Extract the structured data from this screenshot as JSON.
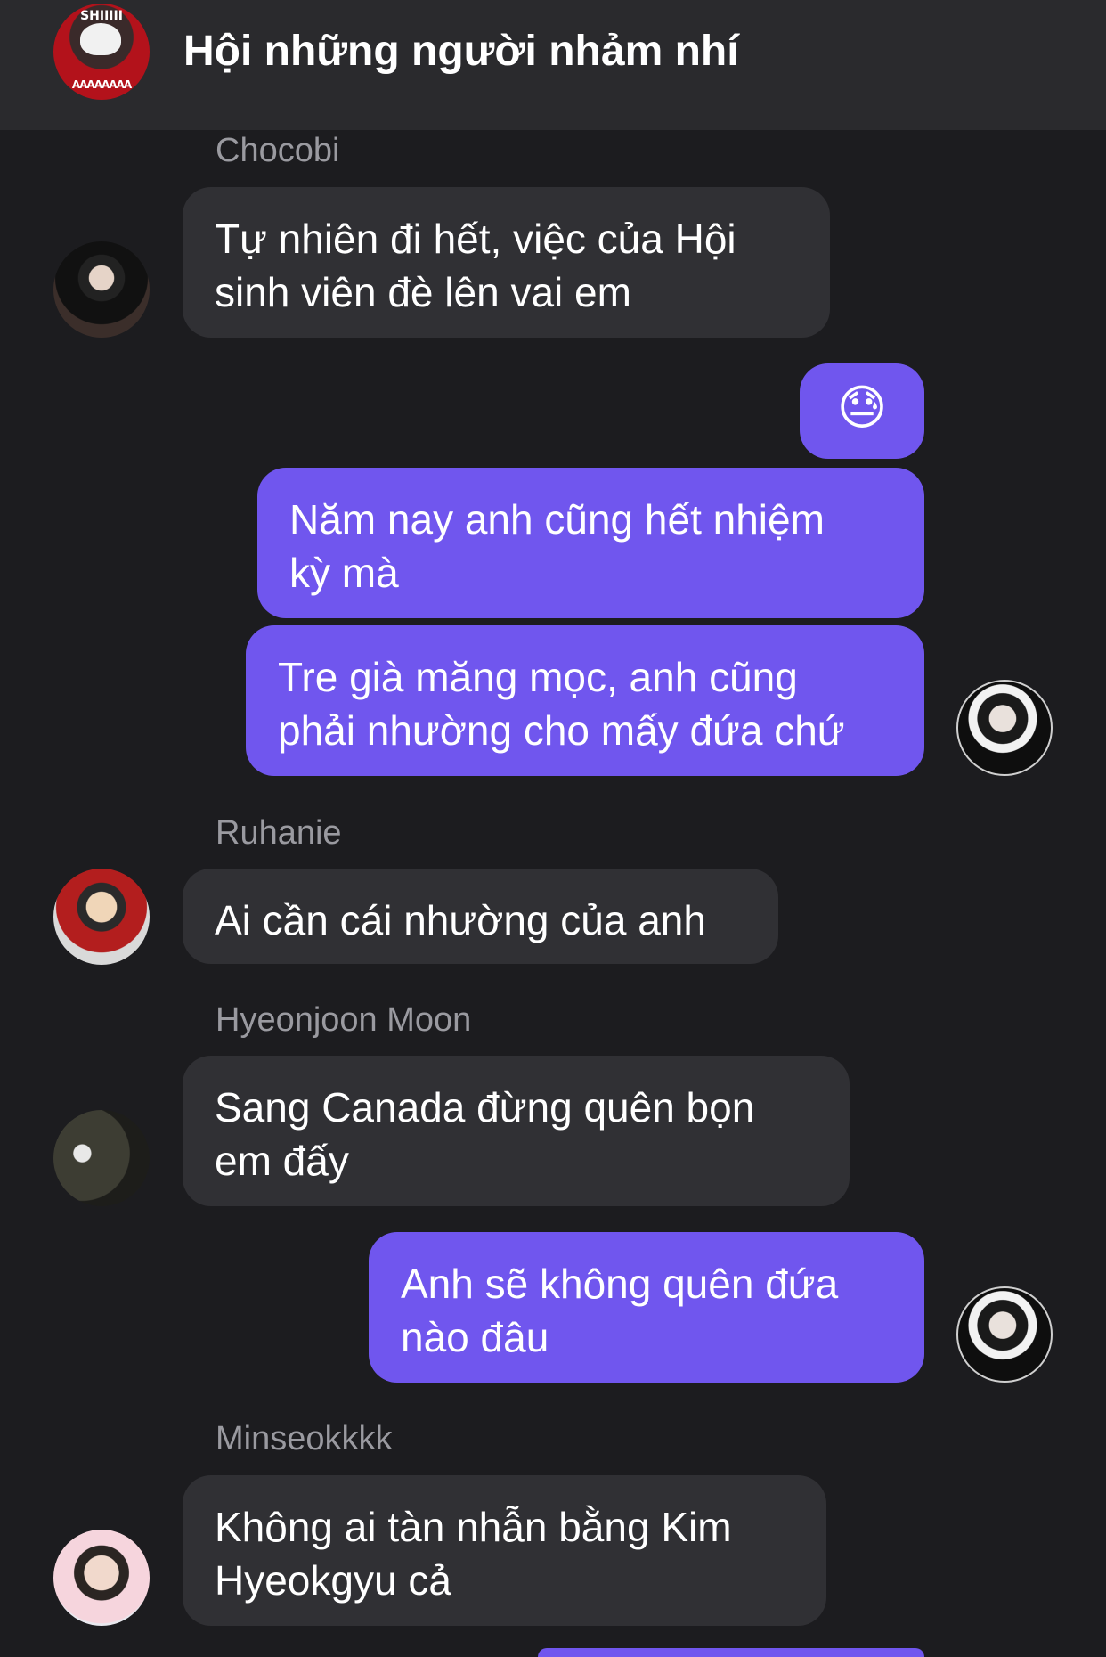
{
  "header": {
    "title": "Hội những người nhảm nhí",
    "avatar_text_top": "SHIIIII",
    "avatar_text_bottom": "AAAAAAAA"
  },
  "messages": [
    {
      "sender": "Chocobi",
      "text": "Tự nhiên đi hết, việc của Hội\nsinh viên đè lên vai em"
    },
    {
      "text": "😓"
    },
    {
      "text": "Năm nay anh cũng hết nhiệm\nkỳ mà"
    },
    {
      "text": "Tre già măng mọc, anh cũng\nphải nhường cho mấy đứa chứ"
    },
    {
      "sender": "Ruhanie",
      "text": "Ai cần cái nhường của anh"
    },
    {
      "sender": "Hyeonjoon Moon",
      "text": "Sang Canada đừng quên bọn\nem đấy"
    },
    {
      "text": "Anh sẽ không quên đứa\nnào đâu"
    },
    {
      "sender": "Minseokkkk",
      "text": "Không ai tàn nhẫn bằng Kim\nHyeokgyu cả"
    }
  ],
  "colors": {
    "background": "#1c1c1f",
    "header": "#2a2a2d",
    "incoming_bubble": "#303034",
    "outgoing_bubble": "#7056ee",
    "sender_name": "#9a9aa0"
  }
}
